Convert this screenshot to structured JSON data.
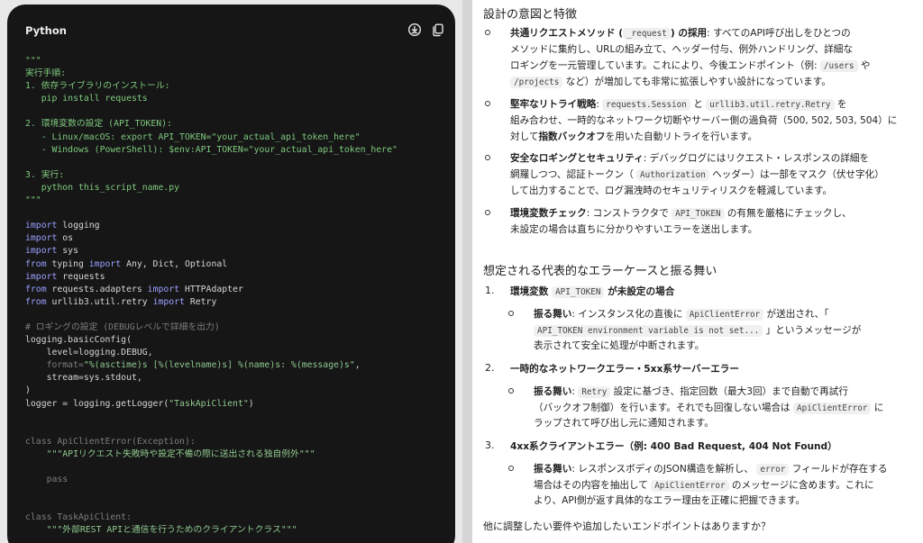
{
  "code_block": {
    "language": "Python",
    "download_icon": "download-icon",
    "copy_icon": "copy-icon",
    "lines": [
      [
        [
          "d",
          "\"\"\""
        ]
      ],
      [
        [
          "d",
          "実行手順:"
        ]
      ],
      [
        [
          "d",
          "1. 依存ライブラリのインストール:"
        ]
      ],
      [
        [
          "d",
          "   pip install requests"
        ]
      ],
      [
        [
          "d",
          ""
        ]
      ],
      [
        [
          "d",
          "2. 環境変数の設定 (API_TOKEN):"
        ]
      ],
      [
        [
          "d",
          "   - Linux/macOS: export API_TOKEN=\"your_actual_api_token_here\""
        ]
      ],
      [
        [
          "d",
          "   - Windows (PowerShell): $env:API_TOKEN=\"your_actual_api_token_here\""
        ]
      ],
      [
        [
          "d",
          ""
        ]
      ],
      [
        [
          "d",
          "3. 実行:"
        ]
      ],
      [
        [
          "d",
          "   python this_script_name.py"
        ]
      ],
      [
        [
          "d",
          "\"\"\""
        ]
      ],
      [
        [
          "t",
          ""
        ]
      ],
      [
        [
          "k",
          "import"
        ],
        [
          "t",
          " logging"
        ]
      ],
      [
        [
          "k",
          "import"
        ],
        [
          "t",
          " os"
        ]
      ],
      [
        [
          "k",
          "import"
        ],
        [
          "t",
          " sys"
        ]
      ],
      [
        [
          "k",
          "from"
        ],
        [
          "t",
          " typing "
        ],
        [
          "k",
          "import"
        ],
        [
          "t",
          " Any, Dict, Optional"
        ]
      ],
      [
        [
          "k",
          "import"
        ],
        [
          "t",
          " requests"
        ]
      ],
      [
        [
          "k",
          "from"
        ],
        [
          "t",
          " requests.adapters "
        ],
        [
          "k",
          "import"
        ],
        [
          "t",
          " HTTPAdapter"
        ]
      ],
      [
        [
          "k",
          "from"
        ],
        [
          "t",
          " urllib3.util.retry "
        ],
        [
          "k",
          "import"
        ],
        [
          "t",
          " Retry"
        ]
      ],
      [
        [
          "t",
          ""
        ]
      ],
      [
        [
          "c",
          "# ロギングの設定 (DEBUGレベルで詳細を出力)"
        ]
      ],
      [
        [
          "t",
          "logging.basicConfig("
        ]
      ],
      [
        [
          "t",
          "    level=logging.DEBUG,"
        ]
      ],
      [
        [
          "c",
          "    format="
        ],
        [
          "s",
          "\"%(asctime)s [%(levelname)s] %(name)s: %(message)s\""
        ],
        [
          "t",
          ","
        ]
      ],
      [
        [
          "t",
          "    stream=sys.stdout,"
        ]
      ],
      [
        [
          "t",
          ")"
        ]
      ],
      [
        [
          "t",
          "logger = logging.getLogger("
        ],
        [
          "s",
          "\"TaskApiClient\""
        ],
        [
          "t",
          ")"
        ]
      ],
      [
        [
          "t",
          ""
        ]
      ],
      [
        [
          "t",
          ""
        ]
      ],
      [
        [
          "c",
          "class"
        ],
        [
          "c",
          " ApiClientError(Exception):"
        ]
      ],
      [
        [
          "s",
          "    \"\"\"APIリクエスト失敗時や設定不備の際に送出される独自例外\"\"\""
        ]
      ],
      [
        [
          "t",
          ""
        ]
      ],
      [
        [
          "c",
          "    pass"
        ]
      ],
      [
        [
          "t",
          ""
        ]
      ],
      [
        [
          "t",
          ""
        ]
      ],
      [
        [
          "c",
          "class"
        ],
        [
          "c",
          " TaskApiClient:"
        ]
      ],
      [
        [
          "s",
          "    \"\"\"外部REST APIと通信を行うためのクライアントクラス\"\"\""
        ]
      ]
    ]
  },
  "doc": {
    "section1_title": "設計の意図と特徴",
    "bullets": [
      {
        "title_pre": "共通リクエストメソッド (",
        "title_code": "_request",
        "title_post": ") の採用",
        "l1_rest": ": すべてのAPI呼び出しをひとつの",
        "l2": "メソッドに集約し、URLの組み立て、ヘッダー付与、例外ハンドリング、詳細な",
        "l3_a": "ロギングを一元管理しています。これにより、今後エンドポイント（例: ",
        "l3_code": "/users",
        "l3_b": " や",
        "l4_code": "/projects",
        "l4_b": " など）が増加しても非常に拡張しやすい設計になっています。"
      },
      {
        "title": "堅牢なリトライ戦略",
        "l1_a": ": ",
        "l1_code1": "requests.Session",
        "l1_mid": " と ",
        "l1_code2": "urllib3.util.retry.Retry",
        "l1_b": " を",
        "l2": "組み合わせ、一時的なネットワーク切断やサーバー側の過負荷（500, 502, 503, 504）に",
        "l3_a": "対して",
        "l3_bold": "指数バックオフ",
        "l3_b": "を用いた自動リトライを行います。"
      },
      {
        "title": "安全なロギングとセキュリティ",
        "l1_rest": ": デバッグログにはリクエスト・レスポンスの詳細を",
        "l2_a": "網羅しつつ、認証トークン（ ",
        "l2_code": "Authorization",
        "l2_b": " ヘッダー）は一部をマスク（伏せ字化）",
        "l3": "して出力することで、ログ漏洩時のセキュリティリスクを軽減しています。"
      },
      {
        "title": "環境変数チェック",
        "l1_a": ": コンストラクタで ",
        "l1_code": "API_TOKEN",
        "l1_b": " の有無を厳格にチェックし、",
        "l2": "未設定の場合は直ちに分かりやすいエラーを送出します。"
      }
    ],
    "section2_title": "想定される代表的なエラーケースと振る舞い",
    "cases": [
      {
        "num": "1.",
        "title_a": "環境変数 ",
        "title_code": "API_TOKEN",
        "title_b": " が未設定の場合",
        "label": "振る舞い",
        "l1_a": ": インスタンス化の直後に ",
        "l1_code": "ApiClientError",
        "l1_b": " が送出され、「",
        "l2_code": "API_TOKEN environment variable is not set...",
        "l2_b": " 」というメッセージが",
        "l3": "表示されて安全に処理が中断されます。"
      },
      {
        "num": "2.",
        "title": "一時的なネットワークエラー・5xx系サーバーエラー",
        "label": "振る舞い",
        "l1_a": ": ",
        "l1_code": "Retry",
        "l1_b": " 設定に基づき、指定回数（最大3回）まで自動で再試行",
        "l2_a": "（バックオフ制御）を行います。それでも回復しない場合は ",
        "l2_code": "ApiClientError",
        "l2_b": " に",
        "l3": "ラップされて呼び出し元に通知されます。"
      },
      {
        "num": "3.",
        "title": "4xx系クライアントエラー（例: 400 Bad Request, 404 Not Found）",
        "label": "振る舞い",
        "l1_a": ": レスポンスボディのJSON構造を解析し、 ",
        "l1_code": "error",
        "l1_b": " フィールドが存在する",
        "l2_a": "場合はその内容を抽出して ",
        "l2_code": "ApiClientError",
        "l2_b": " のメッセージに含めます。これに",
        "l3": "より、API側が返す具体的なエラー理由を正確に把握できます。"
      }
    ],
    "closing": "他に調整したい要件や追加したいエンドポイントはありますか？"
  }
}
